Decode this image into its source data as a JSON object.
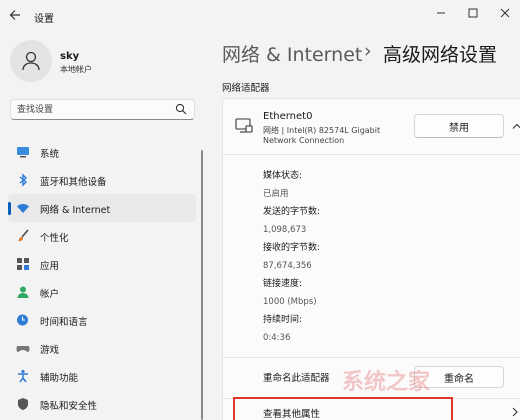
{
  "window": {
    "title": "设置",
    "back_icon": "back-arrow-icon",
    "controls": [
      "minimize-icon",
      "maximize-icon",
      "close-icon"
    ]
  },
  "profile": {
    "name": "sky",
    "account_type": "本地帐户"
  },
  "search": {
    "placeholder": "查找设置"
  },
  "sidebar": {
    "items": [
      {
        "label": "系统",
        "icon": "monitor-icon",
        "color": "#3a8dde"
      },
      {
        "label": "蓝牙和其他设备",
        "icon": "bluetooth-icon",
        "color": "#2f7cd6"
      },
      {
        "label": "网络 & Internet",
        "icon": "wifi-icon",
        "color": "#2f7cd6",
        "active": true
      },
      {
        "label": "个性化",
        "icon": "brush-icon",
        "color": "#e07a2e"
      },
      {
        "label": "应用",
        "icon": "apps-icon",
        "color": "#555555"
      },
      {
        "label": "帐户",
        "icon": "person-icon",
        "color": "#2fa864"
      },
      {
        "label": "时间和语言",
        "icon": "globe-clock-icon",
        "color": "#2f7cd6"
      },
      {
        "label": "游戏",
        "icon": "gamepad-icon",
        "color": "#777777"
      },
      {
        "label": "辅助功能",
        "icon": "accessibility-icon",
        "color": "#2f7cd6"
      },
      {
        "label": "隐私和安全性",
        "icon": "shield-icon",
        "color": "#555555"
      }
    ]
  },
  "header": {
    "parent": "网络 & Internet",
    "separator": "›",
    "current": "高级网络设置"
  },
  "section": {
    "label": "网络适配器"
  },
  "adapter": {
    "name": "Ethernet0",
    "description_line1": "网络 | Intel(R) 82574L Gigabit",
    "description_line2": "Network Connection",
    "disable_label": "禁用",
    "details": [
      {
        "label": "媒体状态:",
        "value": "已启用"
      },
      {
        "label": "发送的字节数:",
        "value": "1,098,673"
      },
      {
        "label": "接收的字节数:",
        "value": "87,674,356"
      },
      {
        "label": "链接速度:",
        "value": "1000 (Mbps)"
      },
      {
        "label": "持续时间:",
        "value": "0:4:36"
      }
    ],
    "rename_label": "重命名此适配器",
    "rename_button": "重命名",
    "more_properties": "查看其他属性"
  },
  "colors": {
    "accent": "#005fb8",
    "highlight": "#e0352b"
  },
  "watermark": "系统之家"
}
